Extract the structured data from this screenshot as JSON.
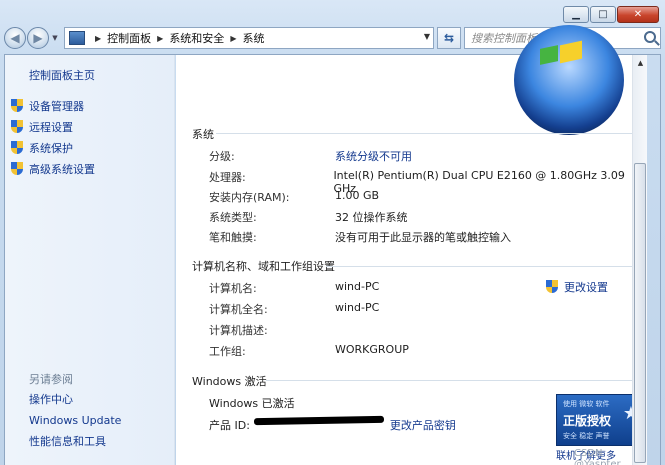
{
  "window": {
    "caption": {
      "minimize": "▁",
      "maximize": "□",
      "close": "✕"
    }
  },
  "navbar": {
    "breadcrumb": [
      "控制面板",
      "系统和安全",
      "系统"
    ],
    "search_placeholder": "搜索控制面板"
  },
  "sidebar": {
    "home": "控制面板主页",
    "items": [
      {
        "label": "设备管理器",
        "icon": "shield-icon"
      },
      {
        "label": "远程设置",
        "icon": "shield-icon"
      },
      {
        "label": "系统保护",
        "icon": "shield-icon"
      },
      {
        "label": "高级系统设置",
        "icon": "shield-icon"
      }
    ],
    "see_also_title": "另请参阅",
    "see_also": [
      "操作中心",
      "Windows Update",
      "性能信息和工具"
    ]
  },
  "system": {
    "title": "系统",
    "rows": [
      {
        "label": "分级:",
        "value": "系统分级不可用",
        "link": true
      },
      {
        "label": "处理器:",
        "value": "Intel(R) Pentium(R) Dual  CPU  E2160  @ 1.80GHz   3.09 GHz",
        "link": false
      },
      {
        "label": "安装内存(RAM):",
        "value": "1.00 GB",
        "link": false
      },
      {
        "label": "系统类型:",
        "value": "32 位操作系统",
        "link": false
      },
      {
        "label": "笔和触摸:",
        "value": "没有可用于此显示器的笔或触控输入",
        "link": false
      }
    ]
  },
  "computer": {
    "title": "计算机名称、域和工作组设置",
    "change_settings": "更改设置",
    "rows": [
      {
        "label": "计算机名:",
        "value": "wind-PC"
      },
      {
        "label": "计算机全名:",
        "value": "wind-PC"
      },
      {
        "label": "计算机描述:",
        "value": ""
      },
      {
        "label": "工作组:",
        "value": "WORKGROUP"
      }
    ]
  },
  "activation": {
    "title": "Windows 激活",
    "status": "Windows 已激活",
    "product_id_label": "产品 ID:",
    "change_key": "更改产品密钥",
    "genuine": {
      "line1": "使用 微软 软件",
      "line2": "正版授权",
      "line3": "安全 稳定 声誉"
    },
    "more_info": "联机了解更多",
    "watermark": "CSDN @Yaspter"
  }
}
